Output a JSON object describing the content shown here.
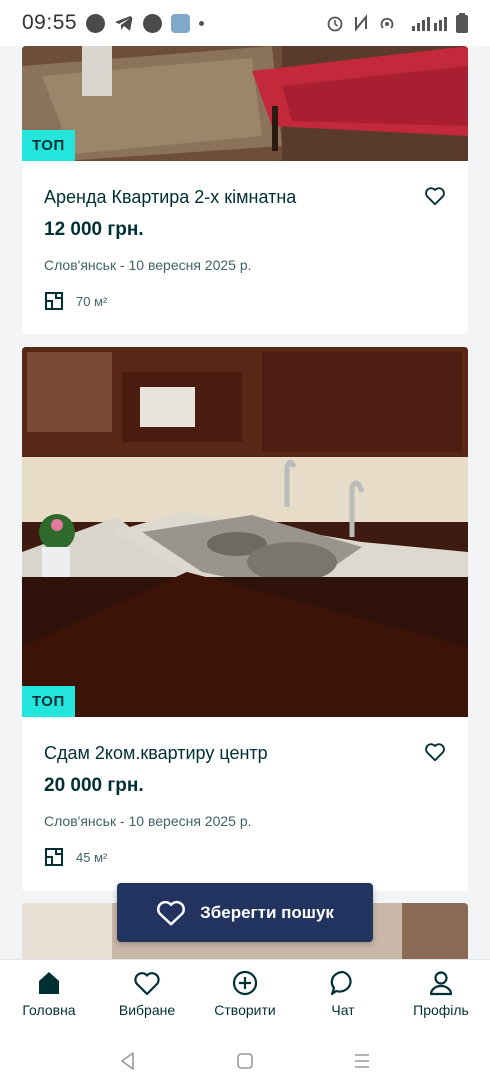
{
  "status_bar": {
    "time": "09:55",
    "icons_left": [
      "facebook-icon",
      "telegram-icon",
      "facebook-icon",
      "app-icon",
      "dot-icon"
    ],
    "icons_right": [
      "alarm-icon",
      "nfc-icon",
      "hotspot-icon",
      "signal-icon",
      "battery-icon"
    ]
  },
  "listings": [
    {
      "badge": "ТОП",
      "title": "Аренда Квартира 2-х кімнатна",
      "price": "12 000 грн.",
      "location_date": "Слов'янськ - 10 вересня 2025 р.",
      "area": "70 м²"
    },
    {
      "badge": "ТОП",
      "title": "Сдам 2ком.квартиру центр",
      "price": "20 000 грн.",
      "location_date": "Слов'янськ - 10 вересня 2025 р.",
      "area": "45 м²"
    }
  ],
  "save_search": {
    "label": "Зберегти пошук"
  },
  "bottom_nav": {
    "items": [
      {
        "label": "Головна",
        "icon": "home-icon"
      },
      {
        "label": "Вибране",
        "icon": "heart-icon"
      },
      {
        "label": "Створити",
        "icon": "plus-circle-icon"
      },
      {
        "label": "Чат",
        "icon": "chat-icon"
      },
      {
        "label": "Профіль",
        "icon": "profile-icon"
      }
    ]
  },
  "colors": {
    "accent_badge": "#23e5db",
    "text_primary": "#002f34",
    "button_dark": "#23335f"
  }
}
